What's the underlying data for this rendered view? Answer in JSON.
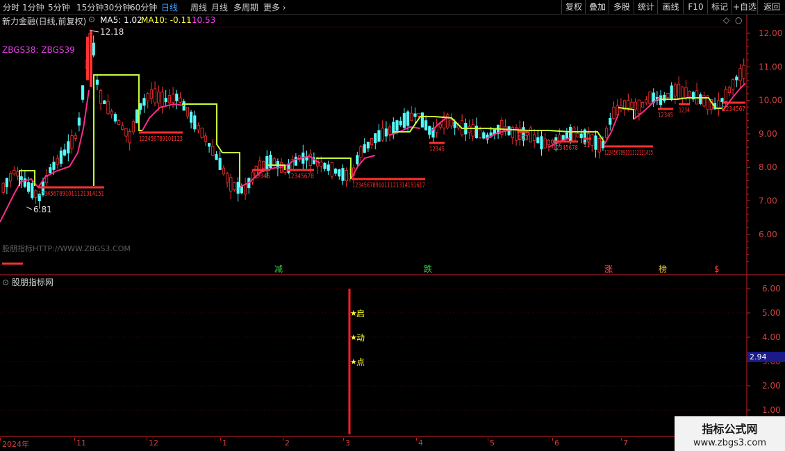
{
  "toolbar": {
    "periods": [
      "分时",
      "1分钟",
      "5分钟",
      "15分钟",
      "30分钟",
      "60分钟",
      "日线",
      "周线",
      "月线",
      "多周期",
      "更多"
    ],
    "active_period": "日线",
    "right_buttons": [
      "复权",
      "叠加",
      "多股",
      "统计",
      "画线",
      "F10",
      "标记",
      "+自选",
      "返回"
    ]
  },
  "info_bar": {
    "stock_title": "新力金融(日线,前复权)",
    "ma5": "MA5: 1.02",
    "ma10": "MA10: -0.11",
    "ma_last": ": 10.53"
  },
  "indicator_label": "ZBGS38: ZBGS39",
  "watermark": "股朋指标HTTP://WWW.ZBGS3.COM",
  "sub_panel": {
    "title": "股朋指标网",
    "star_labels": [
      "启",
      "动",
      "点"
    ],
    "value_box": "2.94",
    "y_ticks": [
      "6.00",
      "5.00",
      "4.00",
      "3.00",
      "2.00",
      "1.00"
    ]
  },
  "price_axis": {
    "ticks": [
      "12.00",
      "11.00",
      "10.00",
      "9.00",
      "8.00",
      "7.00",
      "6.00"
    ],
    "high_label": "12.18",
    "low_label": "6.81"
  },
  "event_markers": [
    "减",
    "跌",
    "涨",
    "榜",
    "$"
  ],
  "date_axis": [
    "2024年",
    "11",
    "12",
    "1",
    "2",
    "3",
    "4",
    "5",
    "6",
    "7"
  ],
  "logo": {
    "line1": "指标公式网",
    "line2": "www.zbgs3.com"
  },
  "colors": {
    "up": "#ff3232",
    "down": "#54fcfc",
    "ma_pink": "#ff2a8c",
    "stair_green": "#c6ff3a",
    "axis_red": "#cc2020",
    "label_red": "#ff3030",
    "marker_green": "#2ecc40"
  }
}
